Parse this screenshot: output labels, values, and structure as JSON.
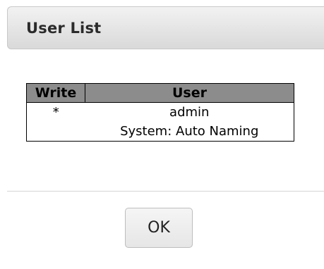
{
  "dialog": {
    "title": "User List"
  },
  "table": {
    "headers": {
      "write": "Write",
      "user": "User"
    },
    "rows": [
      {
        "write": "*",
        "user": "admin"
      },
      {
        "write": "",
        "user": "System: Auto Naming"
      }
    ]
  },
  "buttons": {
    "ok_label": "OK"
  }
}
